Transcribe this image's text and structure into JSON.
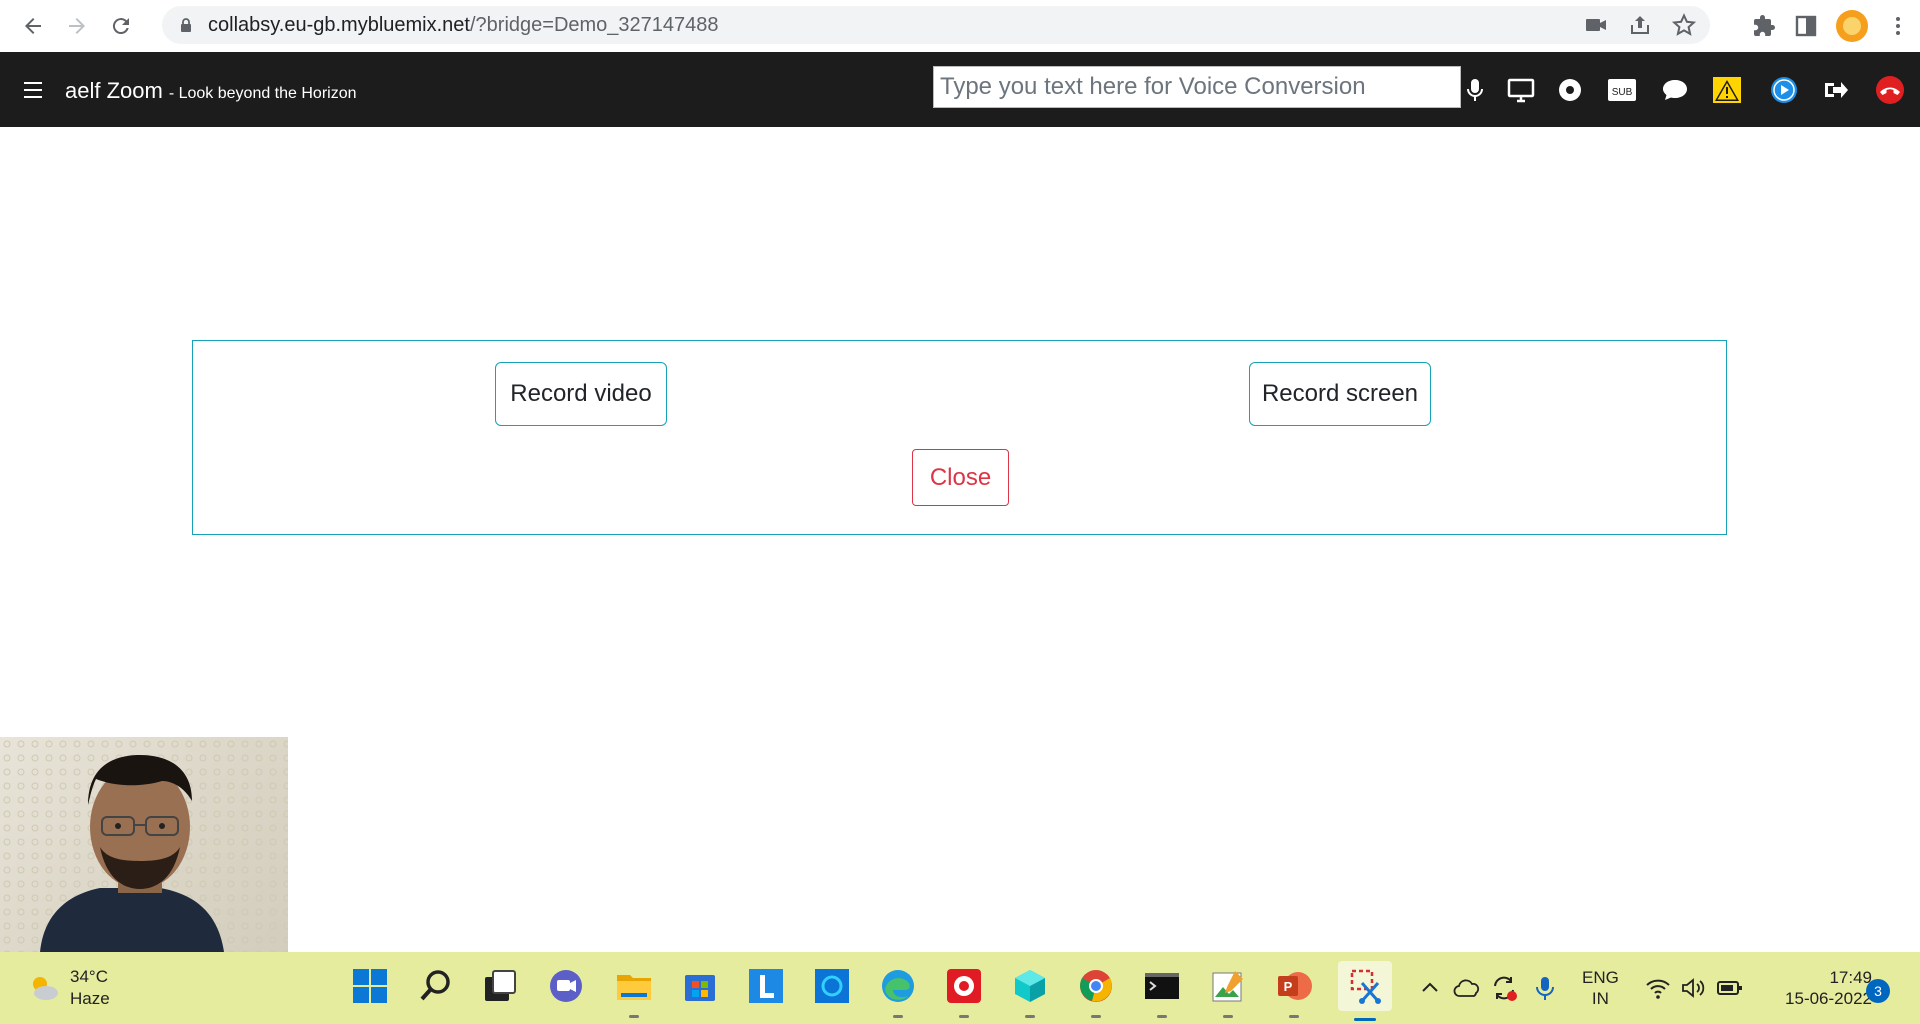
{
  "browser": {
    "url_host": "collabsy.eu-gb.mybluemix.net",
    "url_path": "/?bridge=Demo_327147488",
    "icons": [
      "back-icon",
      "forward-icon",
      "reload-icon",
      "lock-icon",
      "camera-icon",
      "share-icon",
      "star-icon",
      "extensions-icon",
      "sidebar-icon",
      "profile-icon",
      "more-icon"
    ]
  },
  "app": {
    "brand": "aelf Zoom",
    "tagline": "- Look beyond the Horizon",
    "voice_placeholder": "Type you text here for Voice Conversion",
    "toolbar_icons": [
      "video-camera-icon",
      "microphone-icon",
      "screen-share-icon",
      "record-icon",
      "subtitles-icon",
      "chat-icon",
      "warning-icon",
      "play-icon",
      "exit-icon",
      "hangup-icon"
    ],
    "subtitle_badge": "SUB",
    "colors": {
      "header_bg": "#1c1c1c",
      "accent": "#17a2b8",
      "danger": "#dc3545"
    }
  },
  "dialog": {
    "record_video": "Record video",
    "record_screen": "Record screen",
    "close": "Close"
  },
  "taskbar": {
    "weather_temp": "34°C",
    "weather_desc": "Haze",
    "lang_top": "ENG",
    "lang_bottom": "IN",
    "time": "17:49",
    "date": "15-06-2022",
    "notifications": "3",
    "app_icons": [
      "start-icon",
      "search-icon",
      "task-view-icon",
      "teams-chat-icon",
      "file-explorer-icon",
      "store-icon",
      "l-app-icon",
      "alexa-icon",
      "edge-icon",
      "recorder-icon",
      "cube-app-icon",
      "chrome-icon",
      "terminal-icon",
      "photo-editor-icon",
      "powerpoint-icon",
      "snipping-tool-icon"
    ],
    "tray_icons": [
      "chevron-up-icon",
      "onedrive-icon",
      "sync-icon",
      "microphone-icon",
      "wifi-icon",
      "volume-icon",
      "battery-icon"
    ]
  }
}
